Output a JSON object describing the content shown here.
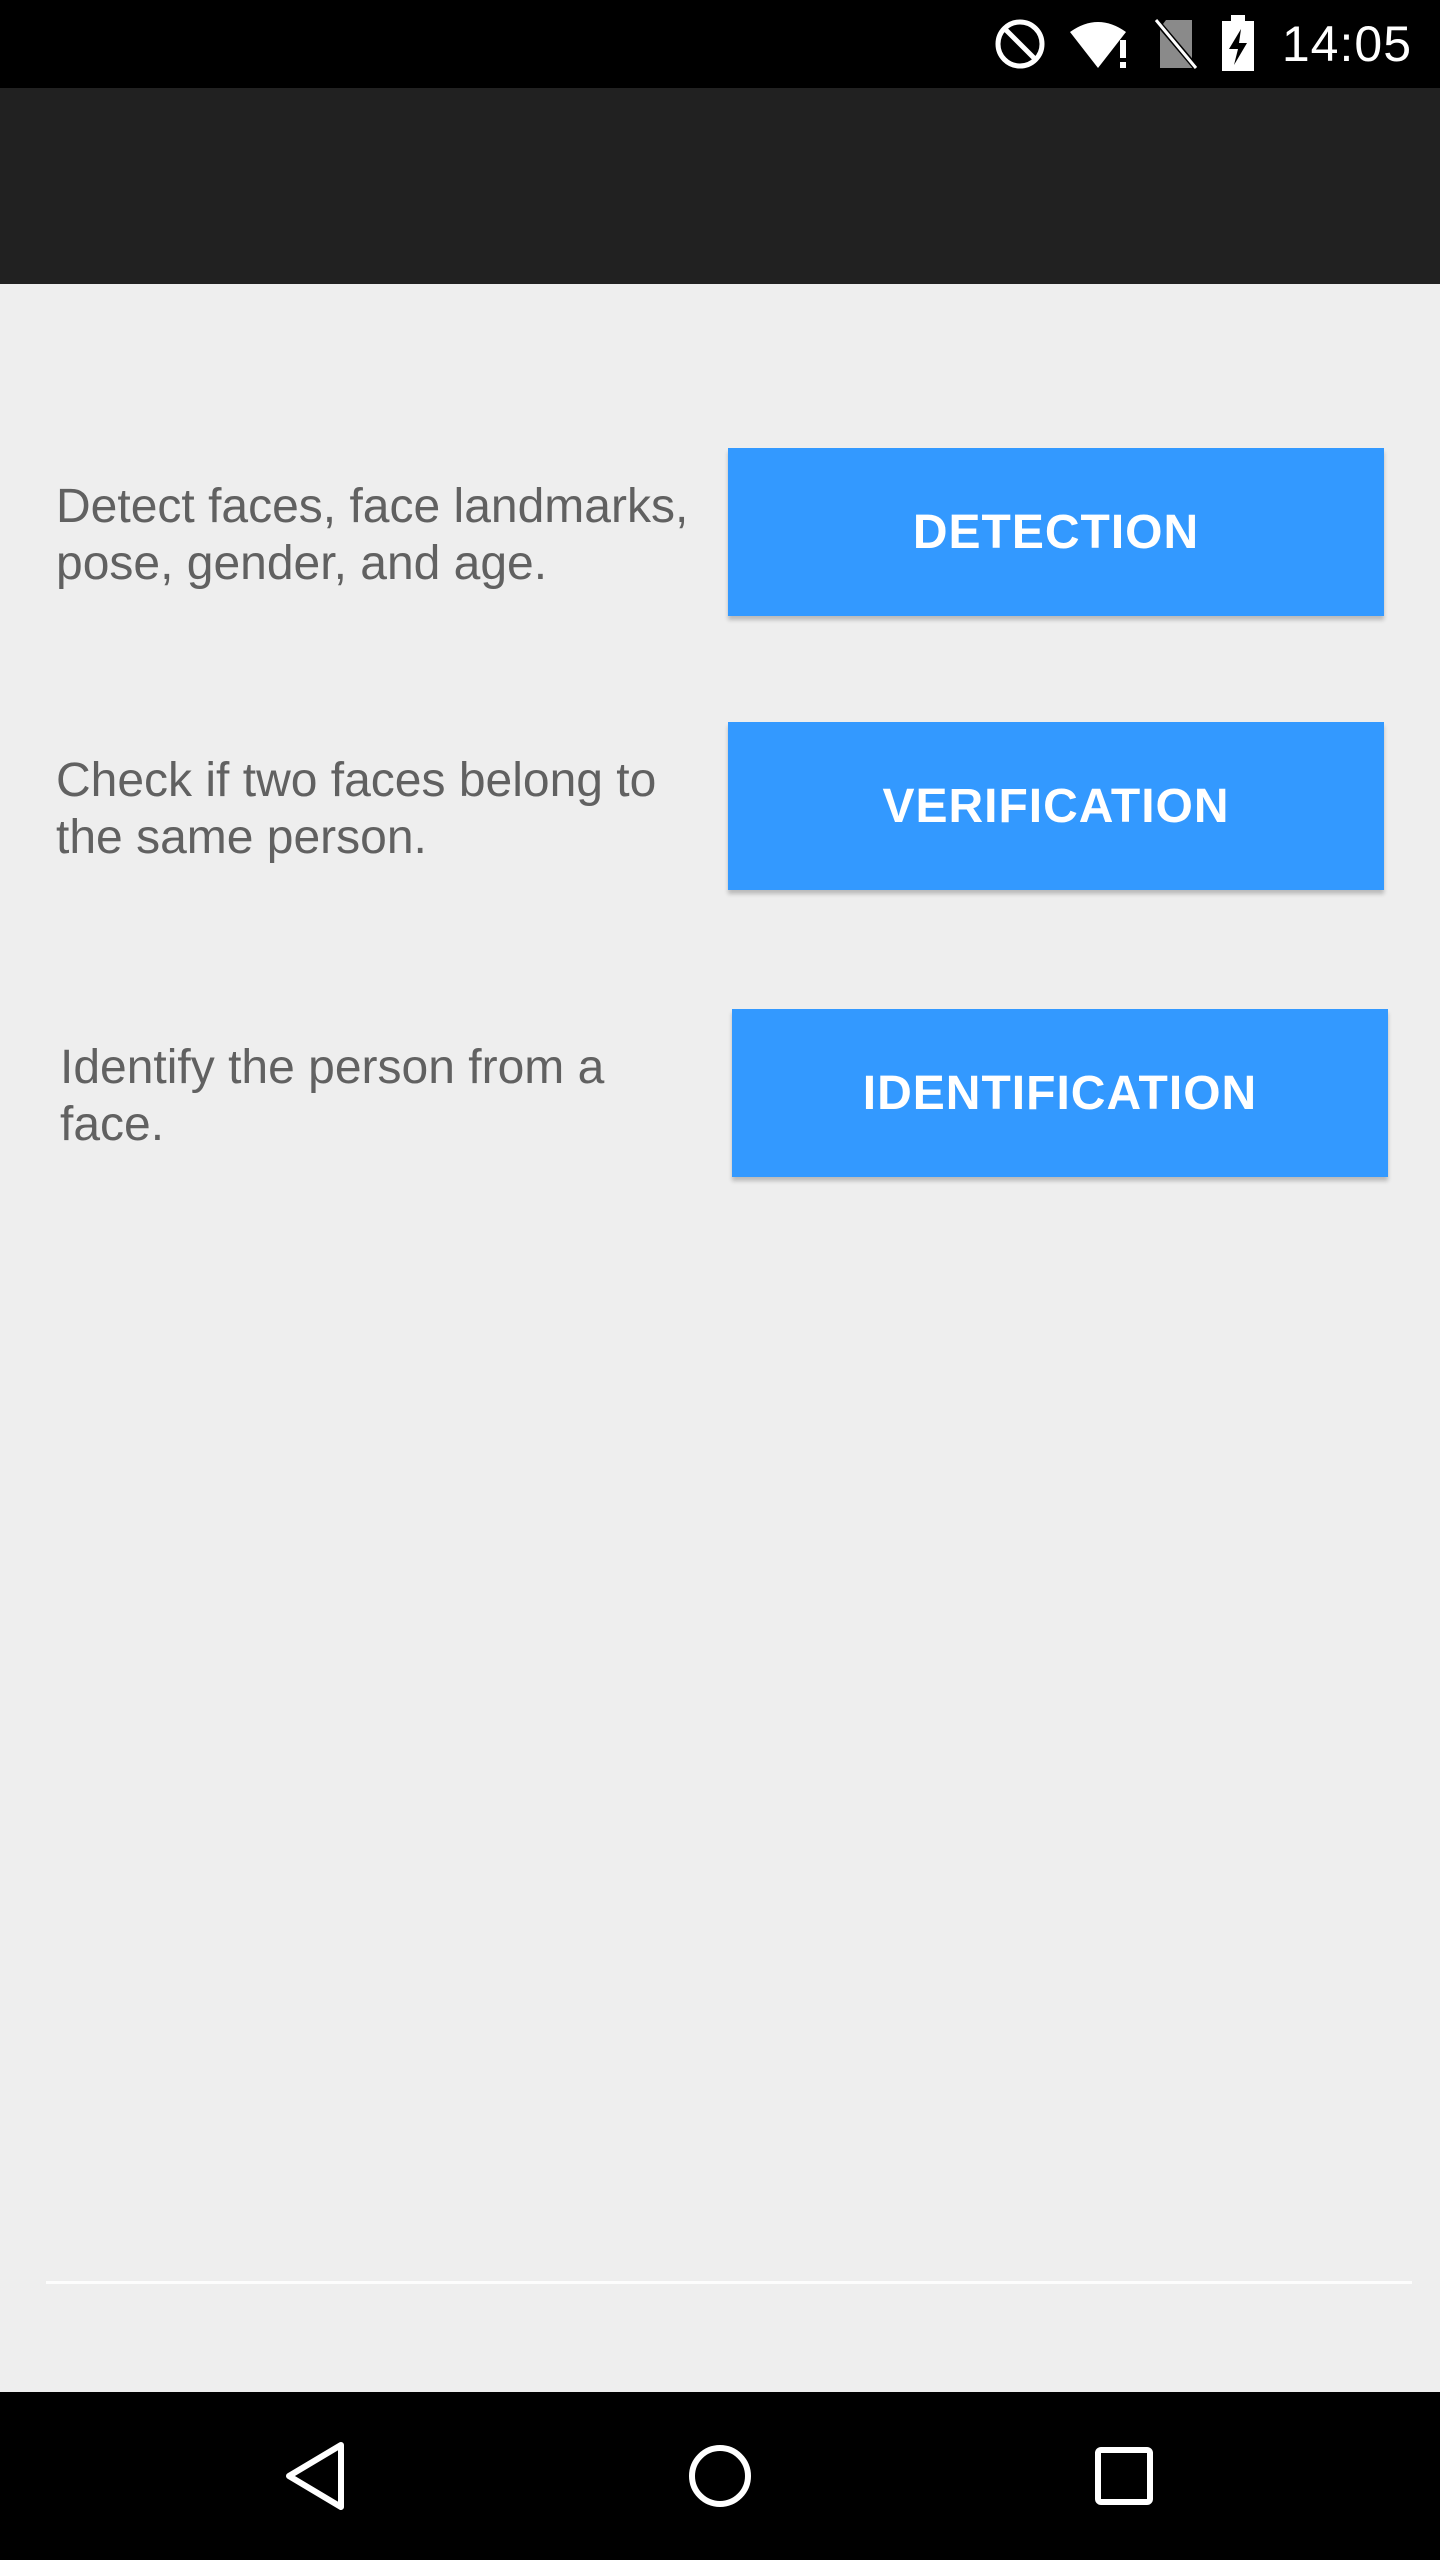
{
  "status_bar": {
    "time": "14:05",
    "icons": [
      "do-not-disturb-icon",
      "wifi-alert-icon",
      "no-sim-icon",
      "battery-charging-icon"
    ]
  },
  "app_bar": {
    "title": ""
  },
  "features": [
    {
      "description": "Detect faces, face landmarks, pose, gender, and age.",
      "button_label": "DETECTION"
    },
    {
      "description": "Check if two faces belong to the same person.",
      "button_label": "VERIFICATION"
    },
    {
      "description": "Identify the person from a face.",
      "button_label": "IDENTIFICATION"
    }
  ],
  "nav_bar": {
    "icons": [
      "back-icon",
      "home-icon",
      "recents-icon"
    ]
  },
  "colors": {
    "accent": "#3399ff",
    "app_bar": "#212121",
    "background": "#eeeeee",
    "text": "#616161"
  }
}
